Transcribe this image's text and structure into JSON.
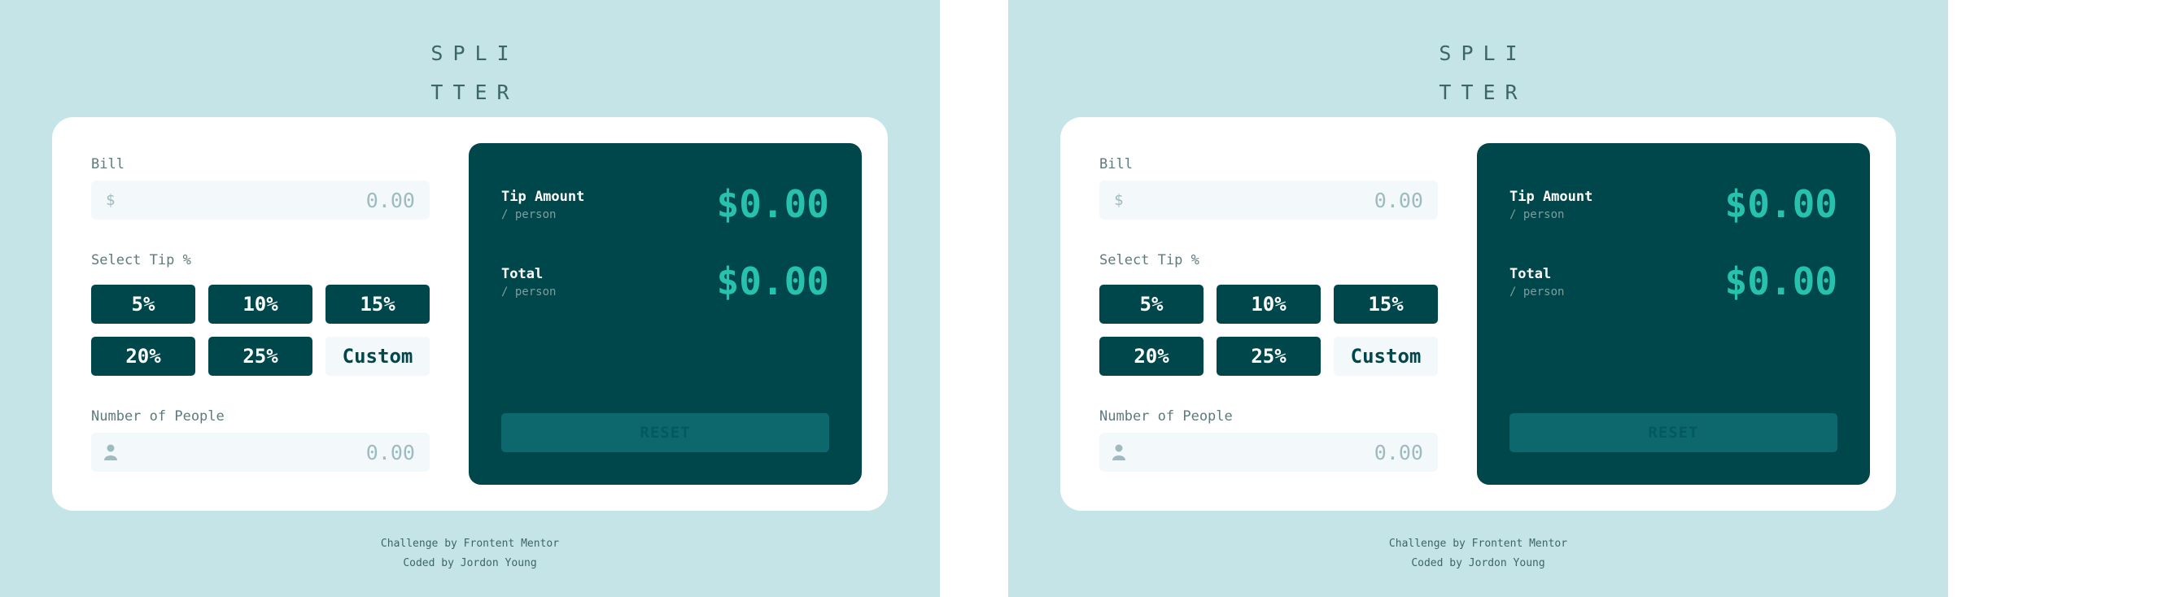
{
  "panels": [
    {
      "logo_line1": "SPLI",
      "logo_line2": "TTER",
      "bill": {
        "label": "Bill",
        "prefix": "$",
        "value": "0.00"
      },
      "tip": {
        "label": "Select Tip %",
        "options": [
          "5%",
          "10%",
          "15%",
          "20%",
          "25%"
        ],
        "custom_label": "Custom"
      },
      "people": {
        "label": "Number of People",
        "value": "0.00"
      },
      "result": {
        "tip_title": "Tip Amount",
        "tip_sub": "/ person",
        "tip_value": "$0.00",
        "total_title": "Total",
        "total_sub": "/ person",
        "total_value": "$0.00",
        "reset_label": "RESET"
      },
      "footer": {
        "line1": "Challenge by Frontent Mentor",
        "line2": "Coded by Jordon Young"
      }
    },
    {
      "logo_line1": "SPLI",
      "logo_line2": "TTER",
      "bill": {
        "label": "Bill",
        "prefix": "$",
        "value": "0.00"
      },
      "tip": {
        "label": "Select Tip %",
        "options": [
          "5%",
          "10%",
          "15%",
          "20%",
          "25%"
        ],
        "custom_label": "Custom"
      },
      "people": {
        "label": "Number of People",
        "value": "0.00"
      },
      "result": {
        "tip_title": "Tip Amount",
        "tip_sub": "/ person",
        "tip_value": "$0.00",
        "total_title": "Total",
        "total_sub": "/ person",
        "total_value": "$0.00",
        "reset_label": "RESET"
      },
      "footer": {
        "line1": "Challenge by Frontent Mentor",
        "line2": "Coded by Jordon Young"
      }
    }
  ],
  "colors": {
    "background": "#c5e4e7",
    "dark_cyan": "#00474b",
    "accent": "#26c2ae",
    "input_bg": "#f3f8fb",
    "reset_bg": "#0d686d"
  },
  "icons": {
    "people_field": "person-icon"
  }
}
